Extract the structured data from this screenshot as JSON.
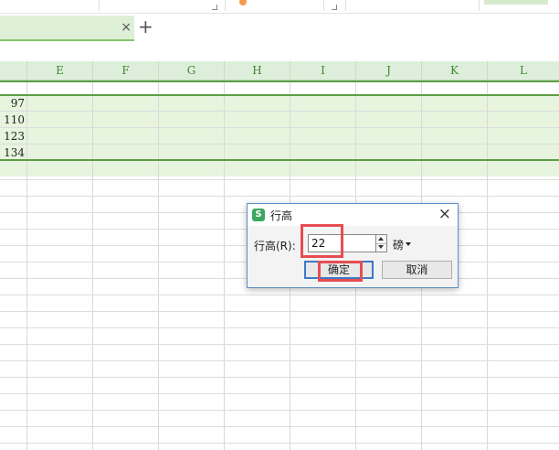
{
  "tab_bar": {
    "close_glyph": "×",
    "add_glyph": "+"
  },
  "grid": {
    "columns": [
      "E",
      "F",
      "G",
      "H",
      "I",
      "J",
      "K",
      "L"
    ],
    "row_values": [
      "97",
      "110",
      "123",
      "134"
    ]
  },
  "dialog": {
    "title": "行高",
    "logo_letter": "S",
    "close_glyph": "×",
    "field_label": "行高(R):",
    "height_value": "22",
    "unit_label": "磅",
    "ok_label": "确定",
    "cancel_label": "取消"
  },
  "colors": {
    "selection_fill": "#e7f4de",
    "header_fill": "#ddeedb",
    "header_text": "#3d8a28",
    "highlight_red": "#e64d52",
    "dialog_border": "#5e8fc9"
  }
}
